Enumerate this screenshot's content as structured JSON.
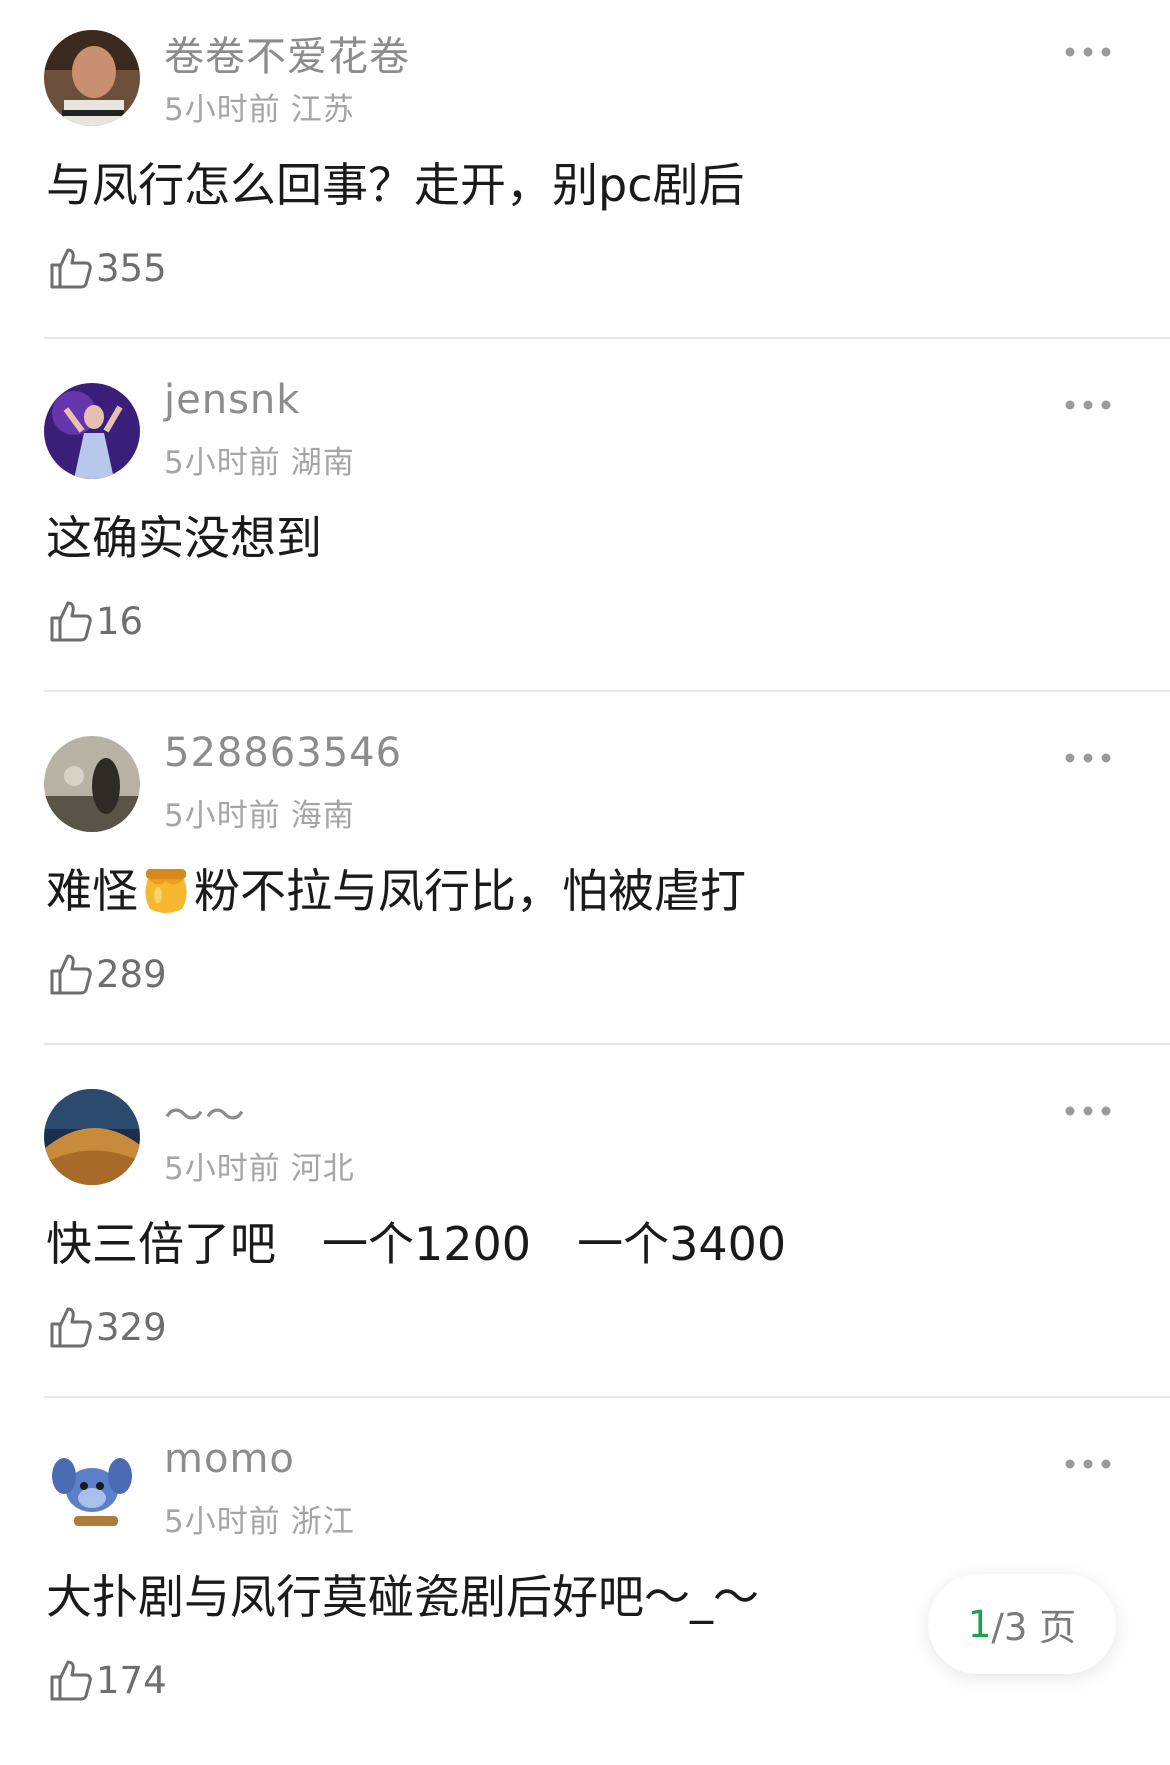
{
  "comments": [
    {
      "username": "卷卷不爱花卷",
      "time": "5小时前",
      "location": "江苏",
      "text": "与凤行怎么回事？走开，别pc剧后",
      "likes": "355"
    },
    {
      "username": "jensnk",
      "time": "5小时前",
      "location": "湖南",
      "text": "这确实没想到",
      "likes": "16"
    },
    {
      "username": "528863546",
      "time": "5小时前",
      "location": "海南",
      "text_before": "难怪",
      "text_after": "粉不拉与凤行比，怕被虐打",
      "likes": "289"
    },
    {
      "username": "～～",
      "time": "5小时前",
      "location": "河北",
      "text": "快三倍了吧　一个1200　一个3400",
      "likes": "329"
    },
    {
      "username": "momo",
      "time": "5小时前",
      "location": "浙江",
      "text": "大扑剧与凤行莫碰瓷剧后好吧～_～",
      "likes": "174"
    }
  ],
  "icons": {
    "more": "more-dots-icon",
    "like": "thumbs-up-icon",
    "emoji": "honey-jar-icon"
  },
  "pager": {
    "current": "1",
    "total_text": "/3 页"
  },
  "colors": {
    "text": "#1a1a1a",
    "meta": "#a5a5a5",
    "accent": "#1aa34a",
    "divider": "#e6e6e6"
  }
}
